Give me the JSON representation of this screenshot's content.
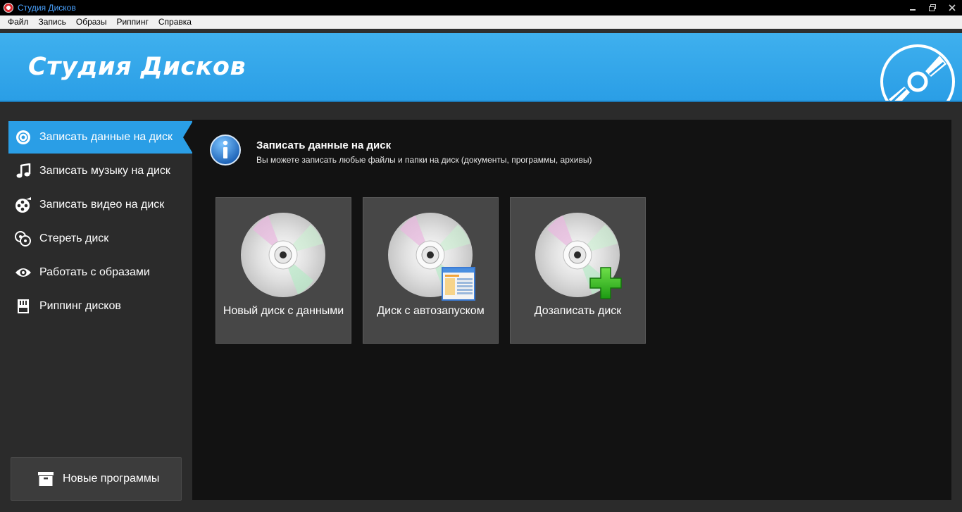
{
  "window": {
    "title": "Студия Дисков"
  },
  "menu": [
    "Файл",
    "Запись",
    "Образы",
    "Риппинг",
    "Справка"
  ],
  "banner": {
    "brand": "Студия Дисков"
  },
  "sidebar": {
    "items": [
      {
        "label": "Записать данные на диск",
        "icon": "disc-icon",
        "active": true
      },
      {
        "label": "Записать музыку на диск",
        "icon": "music-note-icon"
      },
      {
        "label": "Записать видео на диск",
        "icon": "film-reel-icon"
      },
      {
        "label": "Стереть диск",
        "icon": "erase-disc-icon"
      },
      {
        "label": "Работать с образами",
        "icon": "eye-icon"
      },
      {
        "label": "Риппинг дисков",
        "icon": "sd-card-icon"
      }
    ],
    "new_programs": "Новые программы"
  },
  "main": {
    "title": "Записать данные на диск",
    "description": "Вы можете записать любые файлы и папки на диск (документы, программы, архивы)",
    "cards": [
      {
        "label": "Новый диск с данными",
        "icon": "cd-disc-icon"
      },
      {
        "label": "Диск с автозапуском",
        "icon": "cd-autorun-icon"
      },
      {
        "label": "Дозаписать диск",
        "icon": "cd-add-icon"
      }
    ]
  },
  "colors": {
    "accent": "#2a9ee6",
    "panel": "#121212",
    "sidebar": "#2b2b2b",
    "card": "#474747"
  }
}
